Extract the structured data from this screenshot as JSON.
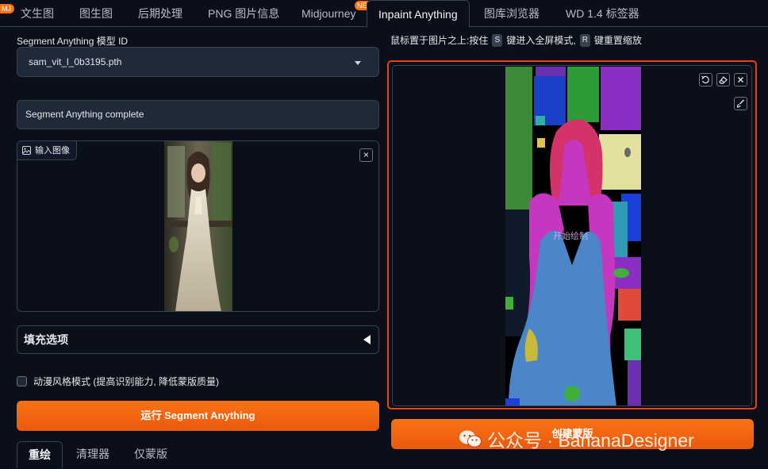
{
  "tabs": [
    {
      "label": "文生图",
      "active": false
    },
    {
      "label": "图生图",
      "active": false
    },
    {
      "label": "后期处理",
      "active": false
    },
    {
      "label": "PNG 图片信息",
      "active": false
    },
    {
      "label": "Midjourney",
      "active": false,
      "badge": "NEW"
    },
    {
      "label": "Inpaint Anything",
      "active": true
    },
    {
      "label": "图库浏览器",
      "active": false
    },
    {
      "label": "WD 1.4 标签器",
      "active": false
    }
  ],
  "corner_badge": "MJ",
  "left": {
    "model_label": "Segment Anything 模型 ID",
    "model_value": "sam_vit_l_0b3195.pth",
    "status_text": "Segment Anything complete",
    "input_image_label": "输入图像",
    "close_symbol": "×",
    "fill_options_label": "填充选项",
    "anime_checkbox_label": "动漫风格模式 (提高识别能力, 降低蒙版质量)",
    "anime_checked": false,
    "run_button": "运行 Segment Anything",
    "subtabs": [
      "重绘",
      "清理器",
      "仅蒙版"
    ]
  },
  "right": {
    "hint_before_s": "鼠标置于图片之上:按住",
    "key_s": "S",
    "hint_middle": "键进入全屏模式,",
    "key_r": "R",
    "hint_after_r": "键重置缩放",
    "canvas_overlay_text": "开始绘制",
    "create_mask_button": "创建蒙版",
    "toolbar_icons": [
      "undo-icon",
      "eraser-icon",
      "close-icon",
      "brush-icon"
    ]
  },
  "watermark": {
    "text": "公众号 · BananaDesigner",
    "icon": "wechat-icon"
  },
  "colors": {
    "accent_orange": "#f97316",
    "highlight_red": "#ef3b24",
    "background": "#0b0f19"
  }
}
